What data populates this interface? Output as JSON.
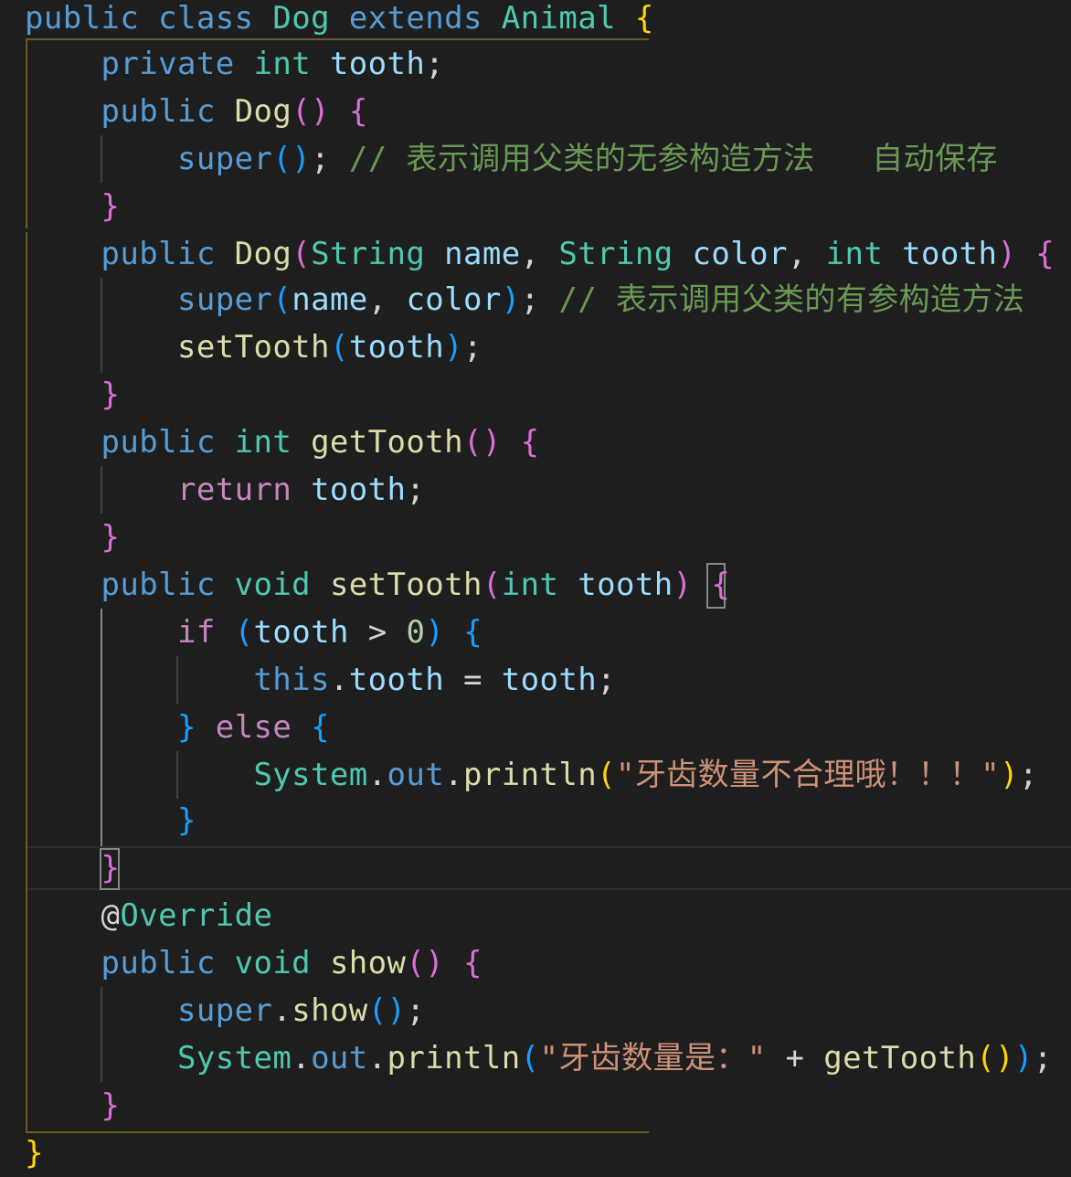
{
  "editor": {
    "language": "java",
    "lines": [
      "public class Dog extends Animal {",
      "    private int tooth;",
      "    public Dog() {",
      "        super(); // 表示调用父类的无参构造方法   自动保存",
      "    }",
      "    public Dog(String name, String color, int tooth) {",
      "        super(name, color); // 表示调用父类的有参构造方法",
      "        setTooth(tooth);",
      "    }",
      "    public int getTooth() {",
      "        return tooth;",
      "    }",
      "    public void setTooth(int tooth) {",
      "        if (tooth > 0) {",
      "            this.tooth = tooth;",
      "        } else {",
      "            System.out.println(\"牙齿数量不合理哦！！！\");",
      "        }",
      "    }",
      "    @Override",
      "    public void show() {",
      "        super.show();",
      "        System.out.println(\"牙齿数量是：\" + getTooth());",
      "    }",
      "}"
    ],
    "cursor_line": 19
  },
  "colors": {
    "background": "#1e1e1e",
    "keyword": "#569cd6",
    "type": "#4ec9b0",
    "function": "#dcdcaa",
    "variable": "#9cdcfe",
    "comment": "#6a9955",
    "string": "#ce9178",
    "number": "#b5cea8",
    "control": "#c586c0",
    "bracket_level_1": "#ffd700",
    "bracket_level_2": "#da70d6",
    "bracket_level_3": "#179fff"
  }
}
